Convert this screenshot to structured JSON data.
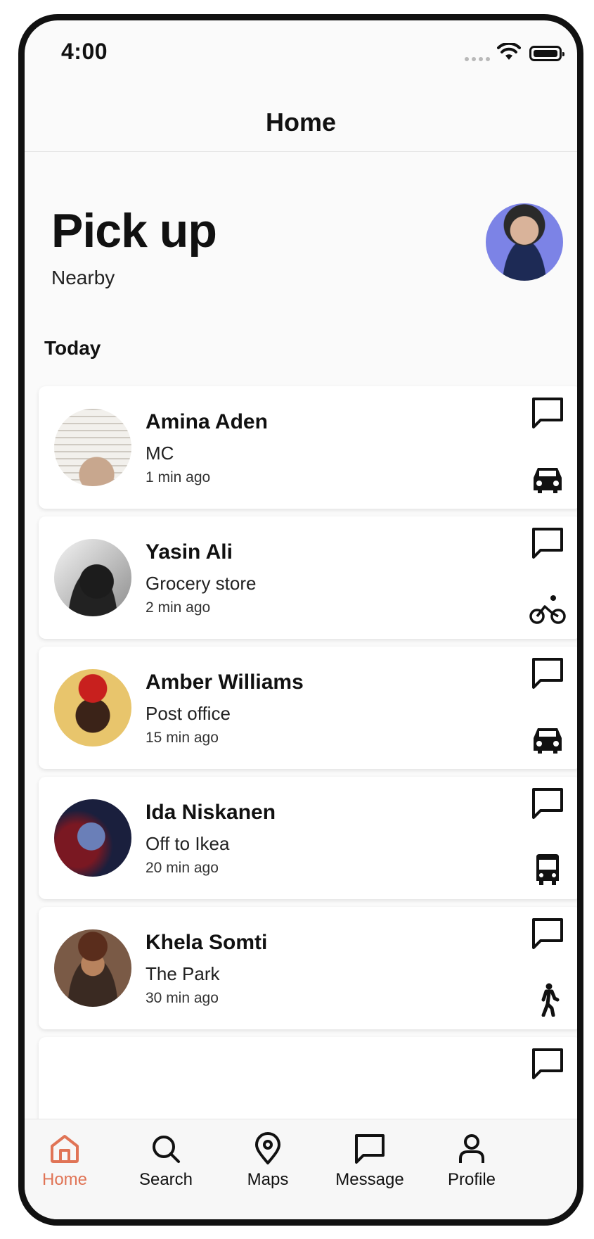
{
  "status_bar": {
    "time": "4:00"
  },
  "nav": {
    "title": "Home"
  },
  "header": {
    "title": "Pick up",
    "subtitle": "Nearby"
  },
  "section": {
    "label": "Today"
  },
  "pickups": [
    {
      "name": "Amina Aden",
      "place": "MC",
      "ago": "1 min ago",
      "mode_icon": "car-icon"
    },
    {
      "name": "Yasin Ali",
      "place": "Grocery store",
      "ago": "2 min ago",
      "mode_icon": "bicycle-icon"
    },
    {
      "name": "Amber Williams",
      "place": "Post office",
      "ago": "15 min ago",
      "mode_icon": "car-icon"
    },
    {
      "name": "Ida Niskanen",
      "place": "Off to Ikea",
      "ago": "20 min ago",
      "mode_icon": "bus-icon"
    },
    {
      "name": "Khela Somti",
      "place": "The Park",
      "ago": "30 min ago",
      "mode_icon": "walking-icon"
    }
  ],
  "tabbar": {
    "items": [
      {
        "label": "Home",
        "icon": "home-icon",
        "active": true
      },
      {
        "label": "Search",
        "icon": "search-icon",
        "active": false
      },
      {
        "label": "Maps",
        "icon": "map-pin-icon",
        "active": false
      },
      {
        "label": "Message",
        "icon": "message-icon",
        "active": false
      },
      {
        "label": "Profile",
        "icon": "profile-icon",
        "active": false
      }
    ]
  },
  "colors": {
    "accent": "#e07456",
    "background": "#fafafa",
    "card": "#ffffff",
    "text": "#111111"
  }
}
